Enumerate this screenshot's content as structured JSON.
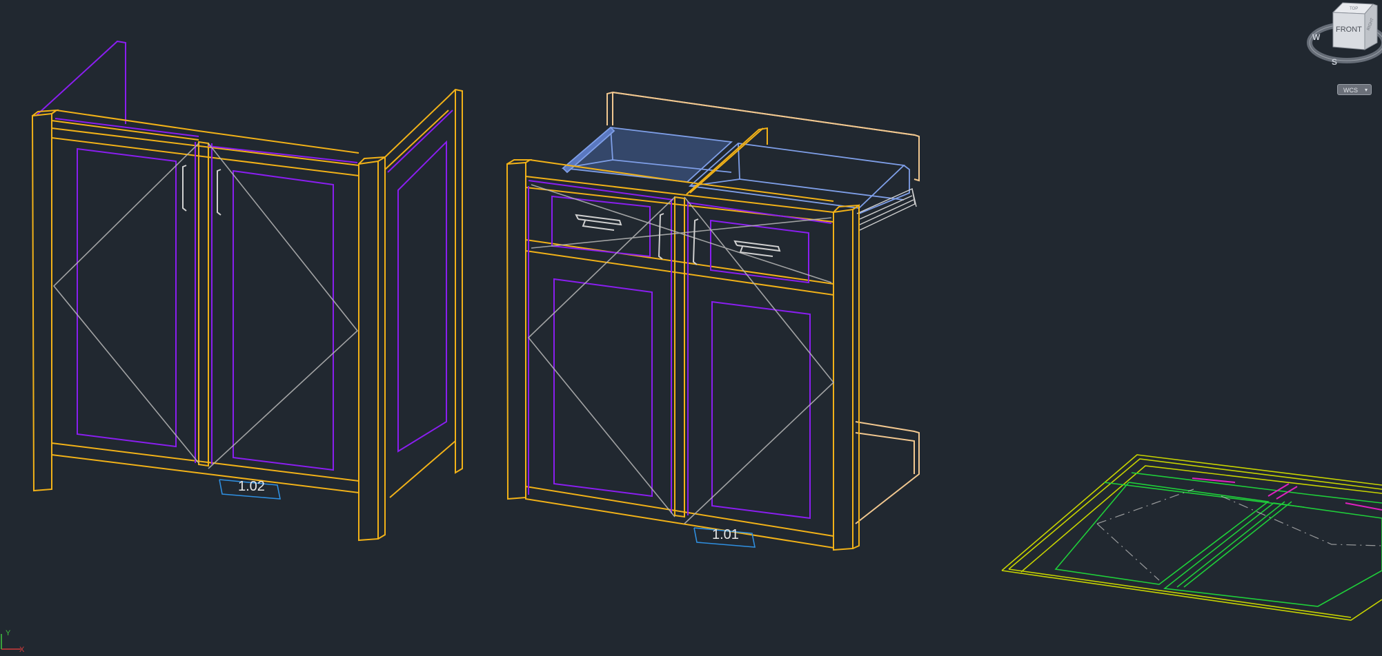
{
  "viewcube": {
    "face_front": "FRONT",
    "face_top": "TOP",
    "face_right": "RIGHT",
    "compass_w": "W",
    "compass_s": "S",
    "coord_system": "WCS",
    "caret": "▾"
  },
  "cabinets": {
    "left_tag": "1.02",
    "middle_tag": "1.01"
  },
  "ucs": {
    "x_label": "X",
    "y_label": "Y"
  },
  "colors": {
    "background": "#212830",
    "cabinet_frame": "#f2b218",
    "door_panel": "#8a1ef0",
    "swing_lines": "#b8b8b8",
    "drawer_box": "#7f9fe8",
    "backsplash": "#f2c890",
    "plan_outline": "#c8d400",
    "plan_inner": "#1fcf3a",
    "tag_leader": "#2f8fe0"
  }
}
